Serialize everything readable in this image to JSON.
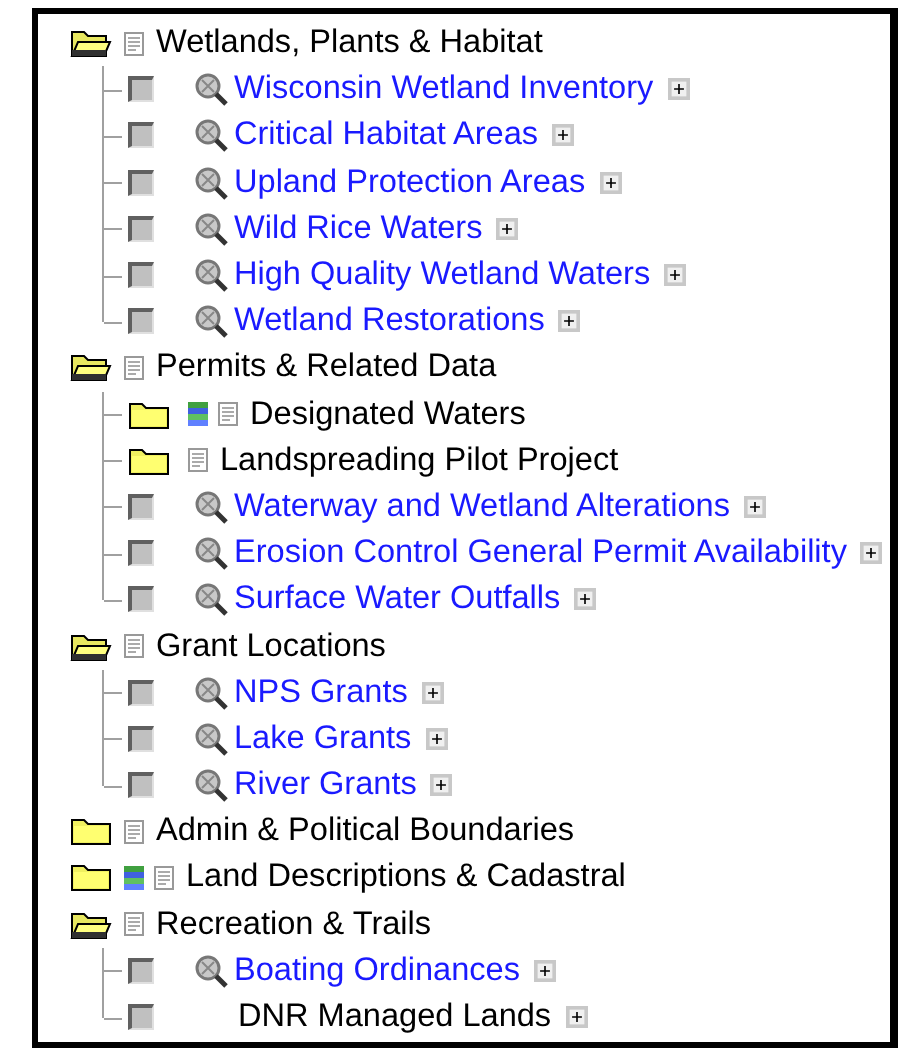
{
  "groups": [
    {
      "label": "Wetlands, Plants & Habitat",
      "expanded": true,
      "legend": false,
      "children": [
        {
          "kind": "layer",
          "label": "Wisconsin Wetland Inventory",
          "checked": false
        },
        {
          "kind": "layer",
          "label": "Critical Habitat Areas",
          "checked": false
        },
        {
          "kind": "layer",
          "label": "Upland Protection Areas",
          "checked": false
        },
        {
          "kind": "layer",
          "label": "Wild Rice Waters",
          "checked": false
        },
        {
          "kind": "layer",
          "label": "High Quality Wetland Waters",
          "checked": false
        },
        {
          "kind": "layer",
          "label": "Wetland Restorations",
          "checked": false
        }
      ]
    },
    {
      "label": "Permits & Related Data",
      "expanded": true,
      "legend": false,
      "children": [
        {
          "kind": "folder",
          "label": "Designated Waters",
          "legend": true
        },
        {
          "kind": "folder",
          "label": "Landspreading Pilot Project",
          "legend": false
        },
        {
          "kind": "layer",
          "label": "Waterway and Wetland Alterations",
          "checked": false
        },
        {
          "kind": "layer",
          "label": "Erosion Control General Permit Availability",
          "checked": false
        },
        {
          "kind": "layer",
          "label": "Surface Water Outfalls",
          "checked": false
        }
      ]
    },
    {
      "label": "Grant Locations",
      "expanded": true,
      "legend": false,
      "children": [
        {
          "kind": "layer",
          "label": "NPS Grants",
          "checked": false
        },
        {
          "kind": "layer",
          "label": "Lake Grants",
          "checked": false
        },
        {
          "kind": "layer",
          "label": "River Grants",
          "checked": false
        }
      ]
    },
    {
      "label": "Admin & Political Boundaries",
      "expanded": false,
      "legend": false
    },
    {
      "label": "Land Descriptions & Cadastral",
      "expanded": false,
      "legend": true
    },
    {
      "label": "Recreation & Trails",
      "expanded": true,
      "legend": false,
      "children": [
        {
          "kind": "layer",
          "label": "Boating Ordinances",
          "checked": false
        },
        {
          "kind": "plain",
          "label": "DNR Managed Lands",
          "checked": false
        }
      ]
    }
  ]
}
